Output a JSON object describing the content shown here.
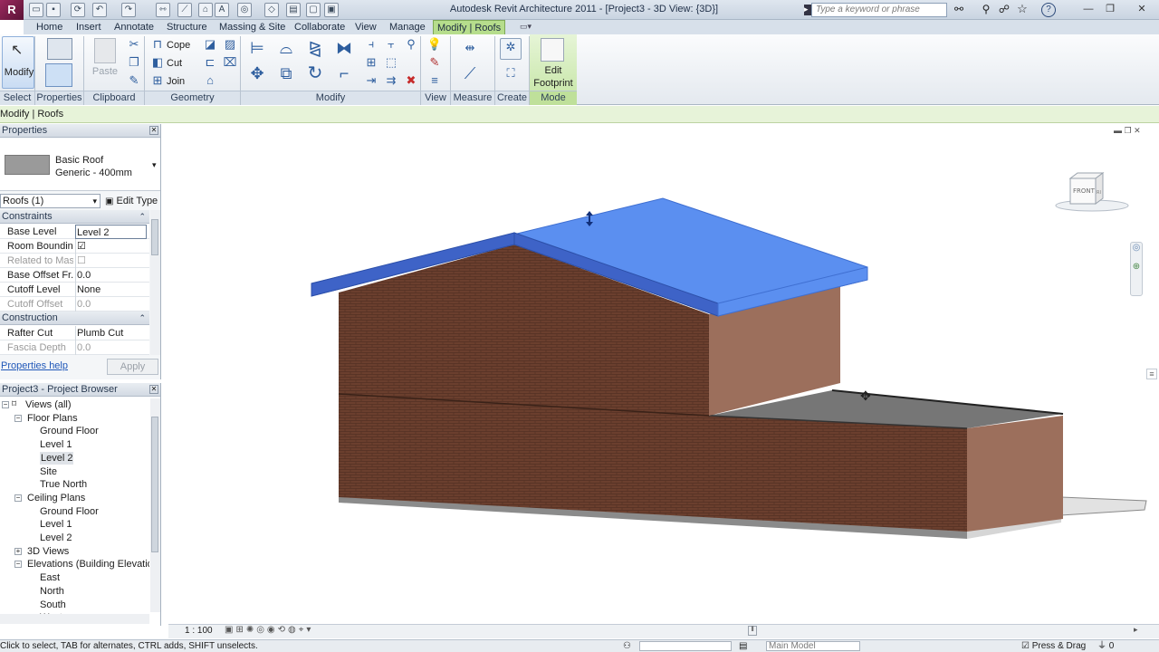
{
  "window": {
    "title": "Autodesk Revit Architecture 2011 - [Project3 - 3D View: {3D}]",
    "search_placeholder": "Type a keyword or phrase",
    "app_logo": "R"
  },
  "tabs": [
    "Home",
    "Insert",
    "Annotate",
    "Structure",
    "Massing & Site",
    "Collaborate",
    "View",
    "Manage",
    "Modify | Roofs"
  ],
  "ribbon": {
    "select": {
      "button": "Modify",
      "panel": "Select"
    },
    "properties": {
      "panel": "Properties"
    },
    "clipboard": {
      "paste": "Paste",
      "panel": "Clipboard"
    },
    "geometry": {
      "cope": "Cope",
      "cut": "Cut",
      "join": "Join",
      "panel": "Geometry"
    },
    "modify": {
      "panel": "Modify"
    },
    "view": {
      "panel": "View"
    },
    "measure": {
      "panel": "Measure"
    },
    "create": {
      "panel": "Create"
    },
    "mode": {
      "button_line1": "Edit",
      "button_line2": "Footprint",
      "panel": "Mode"
    }
  },
  "context_bar": "Modify | Roofs",
  "properties": {
    "title": "Properties",
    "type_family": "Basic Roof",
    "type_name": "Generic - 400mm",
    "selector": "Roofs (1)",
    "edit_type": "Edit Type",
    "groups": [
      {
        "name": "Constraints",
        "rows": [
          {
            "name": "Base Level",
            "value": "Level 2",
            "disabled": false
          },
          {
            "name": "Room Bounding",
            "value": "☑",
            "disabled": false
          },
          {
            "name": "Related to Mass",
            "value": "☐",
            "disabled": true
          },
          {
            "name": "Base Offset Fr...",
            "value": "0.0",
            "disabled": false
          },
          {
            "name": "Cutoff Level",
            "value": "None",
            "disabled": false
          },
          {
            "name": "Cutoff Offset",
            "value": "0.0",
            "disabled": true
          }
        ]
      },
      {
        "name": "Construction",
        "rows": [
          {
            "name": "Rafter Cut",
            "value": "Plumb Cut",
            "disabled": false
          },
          {
            "name": "Fascia Depth",
            "value": "0.0",
            "disabled": true
          }
        ]
      }
    ],
    "help_link": "Properties help",
    "apply": "Apply"
  },
  "project_browser": {
    "title": "Project3 - Project Browser",
    "items": [
      {
        "label": "Views (all)",
        "level": 0,
        "expander": "−",
        "icon": true
      },
      {
        "label": "Floor Plans",
        "level": 1,
        "expander": "−"
      },
      {
        "label": "Ground Floor",
        "level": 2
      },
      {
        "label": "Level 1",
        "level": 2
      },
      {
        "label": "Level 2",
        "level": 2,
        "selected": true
      },
      {
        "label": "Site",
        "level": 2
      },
      {
        "label": "True North",
        "level": 2
      },
      {
        "label": "Ceiling Plans",
        "level": 1,
        "expander": "−"
      },
      {
        "label": "Ground Floor",
        "level": 2
      },
      {
        "label": "Level 1",
        "level": 2
      },
      {
        "label": "Level 2",
        "level": 2
      },
      {
        "label": "3D Views",
        "level": 1,
        "expander": "+"
      },
      {
        "label": "Elevations (Building Elevation",
        "level": 1,
        "expander": "−"
      },
      {
        "label": "East",
        "level": 2
      },
      {
        "label": "North",
        "level": 2
      },
      {
        "label": "South",
        "level": 2
      },
      {
        "label": "West",
        "level": 2
      }
    ]
  },
  "viewcube": {
    "front": "FRONT",
    "right": "RIGHT"
  },
  "view_control": {
    "scale": "1 : 100"
  },
  "status": {
    "message": "Click to select, TAB for alternates, CTRL adds, SHIFT unselects.",
    "model": "Main Model",
    "press_drag": "Press & Drag"
  },
  "colors": {
    "roof": "#5b8ff0",
    "brick": "#6b3f2e",
    "wall_side": "#9c6f5c",
    "flat_roof": "#767676",
    "context_tab": "#b6dd8c"
  }
}
